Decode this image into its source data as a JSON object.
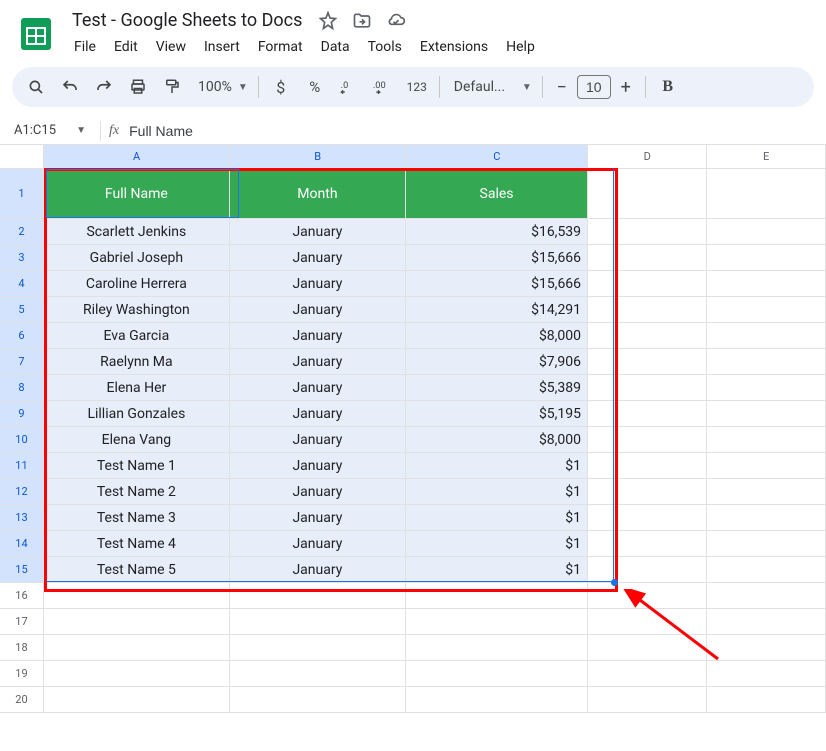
{
  "doc": {
    "title": "Test - Google Sheets to Docs"
  },
  "menu": {
    "items": [
      "File",
      "Edit",
      "View",
      "Insert",
      "Format",
      "Data",
      "Tools",
      "Extensions",
      "Help"
    ]
  },
  "toolbar": {
    "zoom": "100%",
    "font": "Defaul...",
    "fontsize": "10"
  },
  "namebox": {
    "ref": "A1:C15"
  },
  "fx": {
    "value": "Full Name"
  },
  "columns": [
    "A",
    "B",
    "C",
    "D",
    "E"
  ],
  "headers": {
    "a": "Full Name",
    "b": "Month",
    "c": "Sales"
  },
  "chart_data": {
    "type": "table",
    "columns": [
      "Full Name",
      "Month",
      "Sales"
    ],
    "rows": [
      {
        "name": "Scarlett Jenkins",
        "month": "January",
        "sales": "$16,539"
      },
      {
        "name": "Gabriel Joseph",
        "month": "January",
        "sales": "$15,666"
      },
      {
        "name": "Caroline Herrera",
        "month": "January",
        "sales": "$15,666"
      },
      {
        "name": "Riley Washington",
        "month": "January",
        "sales": "$14,291"
      },
      {
        "name": "Eva Garcia",
        "month": "January",
        "sales": "$8,000"
      },
      {
        "name": "Raelynn Ma",
        "month": "January",
        "sales": "$7,906"
      },
      {
        "name": "Elena Her",
        "month": "January",
        "sales": "$5,389"
      },
      {
        "name": "Lillian Gonzales",
        "month": "January",
        "sales": "$5,195"
      },
      {
        "name": "Elena Vang",
        "month": "January",
        "sales": "$8,000"
      },
      {
        "name": "Test Name 1",
        "month": "January",
        "sales": "$1"
      },
      {
        "name": "Test Name 2",
        "month": "January",
        "sales": "$1"
      },
      {
        "name": "Test Name 3",
        "month": "January",
        "sales": "$1"
      },
      {
        "name": "Test Name 4",
        "month": "January",
        "sales": "$1"
      },
      {
        "name": "Test Name 5",
        "month": "January",
        "sales": "$1"
      }
    ]
  },
  "empty_rows": [
    "16",
    "17",
    "18",
    "19",
    "20"
  ]
}
